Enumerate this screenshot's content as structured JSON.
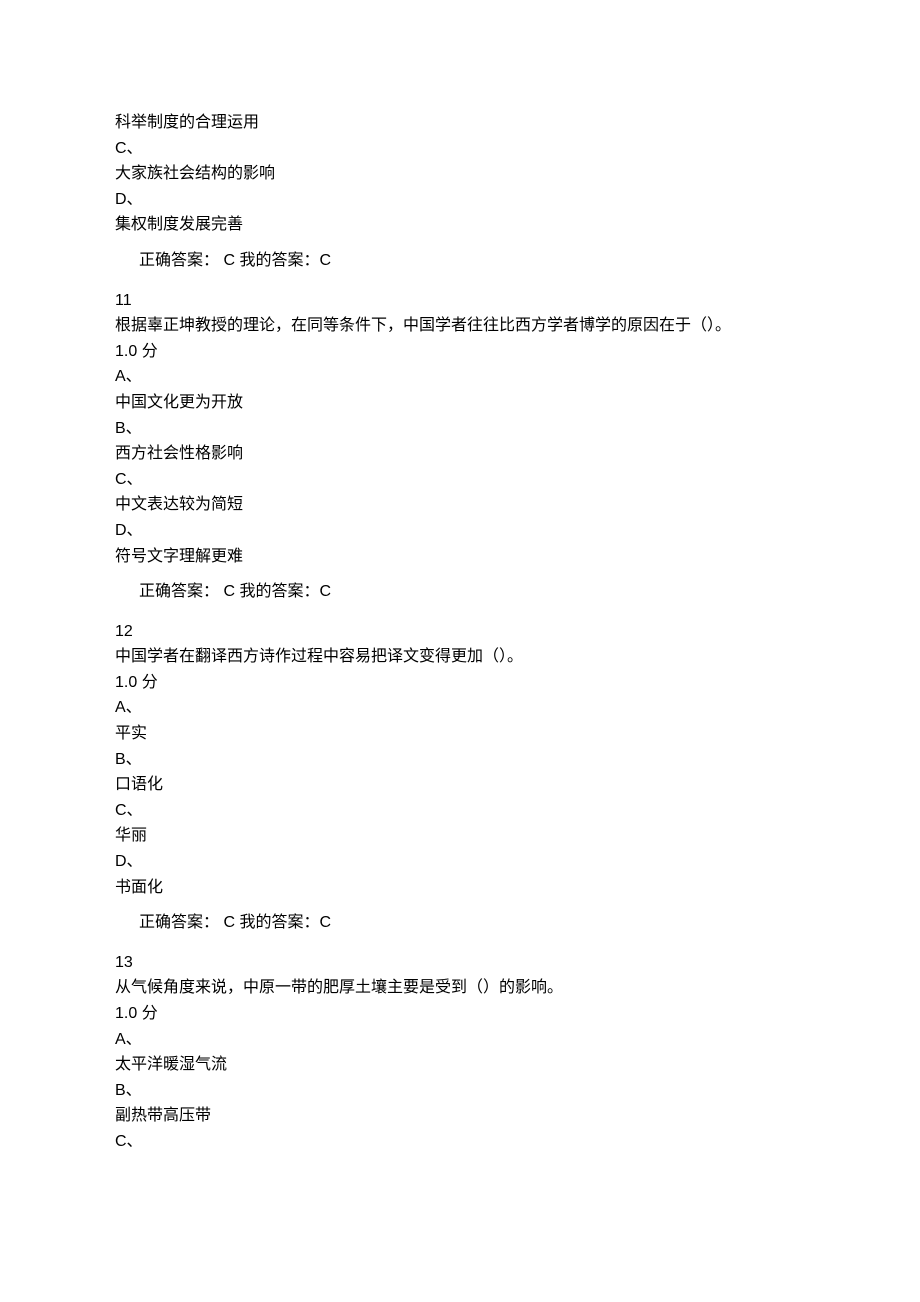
{
  "q10_partial": {
    "option_b_text": "科举制度的合理运用",
    "option_c_label": "C、",
    "option_c_text": "大家族社会结构的影响",
    "option_d_label": "D、",
    "option_d_text": "集权制度发展完善",
    "answer_line": "正确答案： C      我的答案：C"
  },
  "q11": {
    "number": "11",
    "stem": "根据辜正坤教授的理论，在同等条件下，中国学者往往比西方学者博学的原因在于（）。",
    "points": "1.0 分",
    "option_a_label": "A、",
    "option_a_text": "中国文化更为开放",
    "option_b_label": "B、",
    "option_b_text": "西方社会性格影响",
    "option_c_label": "C、",
    "option_c_text": "中文表达较为简短",
    "option_d_label": "D、",
    "option_d_text": "符号文字理解更难",
    "answer_line": "正确答案： C      我的答案：C"
  },
  "q12": {
    "number": "12",
    "stem": "中国学者在翻译西方诗作过程中容易把译文变得更加（）。",
    "points": "1.0 分",
    "option_a_label": "A、",
    "option_a_text": "平实",
    "option_b_label": "B、",
    "option_b_text": "口语化",
    "option_c_label": "C、",
    "option_c_text": "华丽",
    "option_d_label": "D、",
    "option_d_text": "书面化",
    "answer_line": "正确答案： C      我的答案：C"
  },
  "q13": {
    "number": "13",
    "stem": "从气候角度来说，中原一带的肥厚土壤主要是受到（）的影响。",
    "points": "1.0 分",
    "option_a_label": "A、",
    "option_a_text": "太平洋暖湿气流",
    "option_b_label": "B、",
    "option_b_text": "副热带高压带",
    "option_c_label": "C、"
  }
}
